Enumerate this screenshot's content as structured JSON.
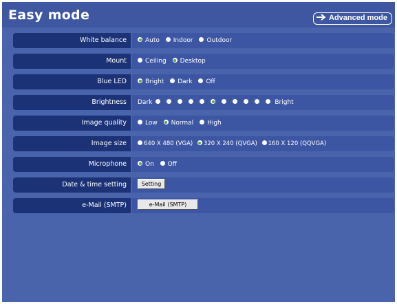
{
  "header": {
    "title": "Easy mode",
    "advanced_button": "Advanced mode"
  },
  "settings": {
    "white_balance": {
      "label": "White balance",
      "options": [
        "Auto",
        "Indoor",
        "Outdoor"
      ],
      "selected": "Auto"
    },
    "mount": {
      "label": "Mount",
      "options": [
        "Ceiling",
        "Desktop"
      ],
      "selected": "Desktop"
    },
    "blue_led": {
      "label": "Blue LED",
      "options": [
        "Bright",
        "Dark",
        "Off"
      ],
      "selected": "Bright"
    },
    "brightness": {
      "label": "Brightness",
      "low_label": "Dark",
      "high_label": "Bright",
      "levels": 11,
      "selected_level": 6
    },
    "image_quality": {
      "label": "Image quality",
      "options": [
        "Low",
        "Normal",
        "High"
      ],
      "selected": "Normal"
    },
    "image_size": {
      "label": "Image size",
      "options": [
        "640 X 480 (VGA)",
        "320 X 240 (QVGA)",
        "160 X 120 (QQVGA)"
      ],
      "selected": "320 X 240 (QVGA)"
    },
    "microphone": {
      "label": "Microphone",
      "options": [
        "On",
        "Off"
      ],
      "selected": "On"
    },
    "date_time": {
      "label": "Date & time setting",
      "button": "Setting"
    },
    "email": {
      "label": "e-Mail (SMTP)",
      "button": "e-Mail (SMTP)"
    }
  },
  "colors": {
    "background": "#4a64ac",
    "label_cell": "#1b3277",
    "value_cell": "#3c56a3",
    "selected_radio": "#55a64a"
  }
}
